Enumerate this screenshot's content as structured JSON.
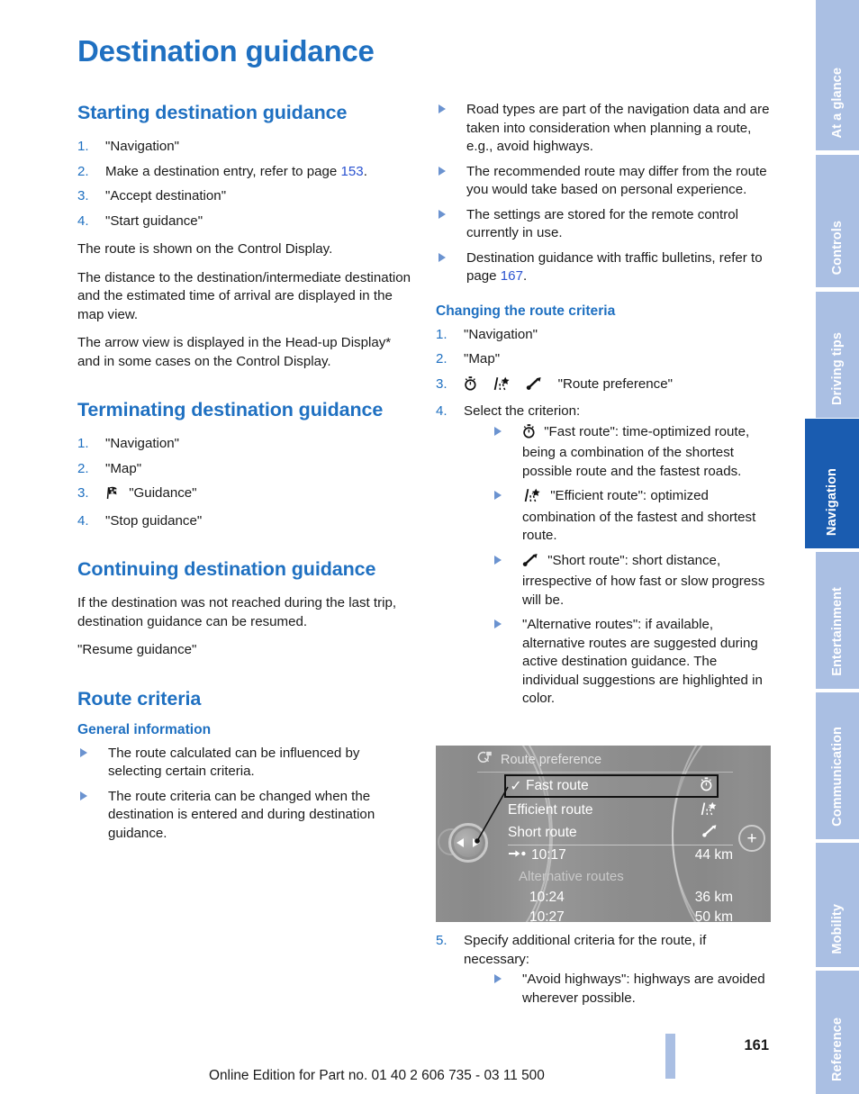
{
  "page_title": "Destination guidance",
  "page_number": "161",
  "footer_note": "Online Edition for Part no. 01 40 2 606 735 - 03 11 500",
  "colors": {
    "heading_blue": "#1f70c1",
    "tab_inactive": "#aabfe3",
    "tab_active": "#1a5cb0",
    "page_ref_link": "#2b53d0",
    "bullet_triangle": "#6b93d0"
  },
  "tabs": [
    {
      "label": "At a glance",
      "active": false
    },
    {
      "label": "Controls",
      "active": false
    },
    {
      "label": "Driving tips",
      "active": false
    },
    {
      "label": "Navigation",
      "active": true
    },
    {
      "label": "Entertainment",
      "active": false
    },
    {
      "label": "Communication",
      "active": false
    },
    {
      "label": "Mobility",
      "active": false
    },
    {
      "label": "Reference",
      "active": false
    }
  ],
  "left_column": {
    "section1": {
      "heading": "Starting destination guidance",
      "steps": [
        {
          "num": "1.",
          "text": "\"Navigation\""
        },
        {
          "num": "2.",
          "pre": "Make a destination entry, refer to page ",
          "ref": "153",
          "post": "."
        },
        {
          "num": "3.",
          "text": "\"Accept destination\""
        },
        {
          "num": "4.",
          "text": "\"Start guidance\""
        }
      ],
      "paragraphs": [
        "The route is shown on the Control Display.",
        "The distance to the destination/intermediate destination and the estimated time of arrival are displayed in the map view.",
        "The arrow view is displayed in the Head-up Display* and in some cases on the Control Display."
      ]
    },
    "section2": {
      "heading": "Terminating destination guidance",
      "steps": [
        {
          "num": "1.",
          "text": "\"Navigation\""
        },
        {
          "num": "2.",
          "text": "\"Map\""
        },
        {
          "num": "3.",
          "icon": "checkered-flag-icon",
          "text": "\"Guidance\""
        },
        {
          "num": "4.",
          "text": "\"Stop guidance\""
        }
      ]
    },
    "section3": {
      "heading": "Continuing destination guidance",
      "paragraphs": [
        "If the destination was not reached during the last trip, destination guidance can be resumed.",
        "\"Resume guidance\""
      ]
    },
    "section4": {
      "heading": "Route criteria",
      "subheading": "General information",
      "bullets": [
        "The route calculated can be influenced by selecting certain criteria.",
        "The route criteria can be changed when the destination is entered and during destination guidance."
      ]
    }
  },
  "right_column": {
    "top_bullets": [
      {
        "text": "Road types are part of the navigation data and are taken into consideration when planning a route, e.g., avoid highways."
      },
      {
        "text": "The recommended route may differ from the route you would take based on personal experience."
      },
      {
        "text": "The settings are stored for the remote control currently in use."
      },
      {
        "pre": "Destination guidance with traffic bulletins, refer to page ",
        "ref": "167",
        "post": "."
      }
    ],
    "section": {
      "subheading": "Changing the route criteria",
      "steps": [
        {
          "num": "1.",
          "text": "\"Navigation\""
        },
        {
          "num": "2.",
          "text": "\"Map\""
        },
        {
          "num": "3.",
          "icons": [
            "stopwatch-icon",
            "efficient-route-icon",
            "short-route-icon"
          ],
          "text": "\"Route preference\""
        },
        {
          "num": "4.",
          "text": "Select the criterion:"
        }
      ],
      "criteria": [
        {
          "icon": "stopwatch-icon",
          "text": "\"Fast route\": time-optimized route, being a combination of the shortest possible route and the fastest roads."
        },
        {
          "icon": "efficient-route-icon",
          "text": "\"Efficient route\": optimized combination of the fastest and shortest route."
        },
        {
          "icon": "short-route-icon",
          "text": "\"Short route\": short distance, irrespective of how fast or slow progress will be."
        },
        {
          "icon": null,
          "text": "\"Alternative routes\": if available, alternative routes are suggested during active destination guidance. The individual suggestions are highlighted in color."
        }
      ],
      "step5": {
        "num": "5.",
        "text": "Specify additional criteria for the route, if necessary:"
      },
      "step5_bullets": [
        "\"Avoid highways\": highways are avoided wherever possible."
      ]
    }
  },
  "display_screenshot": {
    "header_title": "Route preference",
    "header_icon": "map-preference-icon",
    "rows": [
      {
        "label": "Fast route",
        "icon": "stopwatch-icon",
        "checked": true,
        "check_glyph": "✓"
      },
      {
        "label": "Efficient route",
        "icon": "efficient-route-icon",
        "checked": false
      },
      {
        "label": "Short route",
        "icon": "short-route-icon",
        "checked": false
      }
    ],
    "main_info": {
      "time": "10:17",
      "distance": "44 km",
      "lead_icon": "arrow-to-dot-icon"
    },
    "alternatives_label": "Alternative routes",
    "alternatives": [
      {
        "time": "10:24",
        "distance": "36 km"
      },
      {
        "time": "10:27",
        "distance": "50 km"
      }
    ],
    "plus_button": "+",
    "knob_left_arrow": "◀",
    "knob_right_arrow": "▶"
  }
}
